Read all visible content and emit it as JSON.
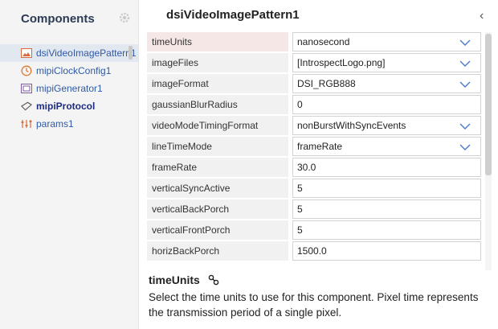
{
  "sidebar": {
    "title": "Components",
    "settings_icon": "gear-icon",
    "items": [
      {
        "label": "dsiVideoImagePattern1",
        "icon": "image-icon"
      },
      {
        "label": "mipiClockConfig1",
        "icon": "clock-icon"
      },
      {
        "label": "mipiGenerator1",
        "icon": "generator-icon"
      },
      {
        "label": "mipiProtocol",
        "icon": "protocol-icon"
      },
      {
        "label": "params1",
        "icon": "params-icon"
      }
    ]
  },
  "panel": {
    "title": "dsiVideoImagePattern1",
    "back_icon": "chevron-left-icon",
    "properties": [
      {
        "name": "timeUnits",
        "value": "nanosecond",
        "dropdown": true
      },
      {
        "name": "imageFiles",
        "value": "[IntrospectLogo.png]",
        "dropdown": true
      },
      {
        "name": "imageFormat",
        "value": "DSI_RGB888",
        "dropdown": true
      },
      {
        "name": "gaussianBlurRadius",
        "value": "0",
        "dropdown": false
      },
      {
        "name": "videoModeTimingFormat",
        "value": "nonBurstWithSyncEvents",
        "dropdown": true
      },
      {
        "name": "lineTimeMode",
        "value": "frameRate",
        "dropdown": true
      },
      {
        "name": "frameRate",
        "value": "30.0",
        "dropdown": false
      },
      {
        "name": "verticalSyncActive",
        "value": "5",
        "dropdown": false
      },
      {
        "name": "verticalBackPorch",
        "value": "5",
        "dropdown": false
      },
      {
        "name": "verticalFrontPorch",
        "value": "5",
        "dropdown": false
      },
      {
        "name": "horizBackPorch",
        "value": "1500.0",
        "dropdown": false
      }
    ]
  },
  "help": {
    "title": "timeUnits",
    "text": "Select the time units to use for this component. Pixel time represents the transmission period of a single pixel."
  },
  "colors": {
    "accent": "#4a79c9",
    "link": "#2f5aa8",
    "selected_row": "#f6e7e7"
  }
}
